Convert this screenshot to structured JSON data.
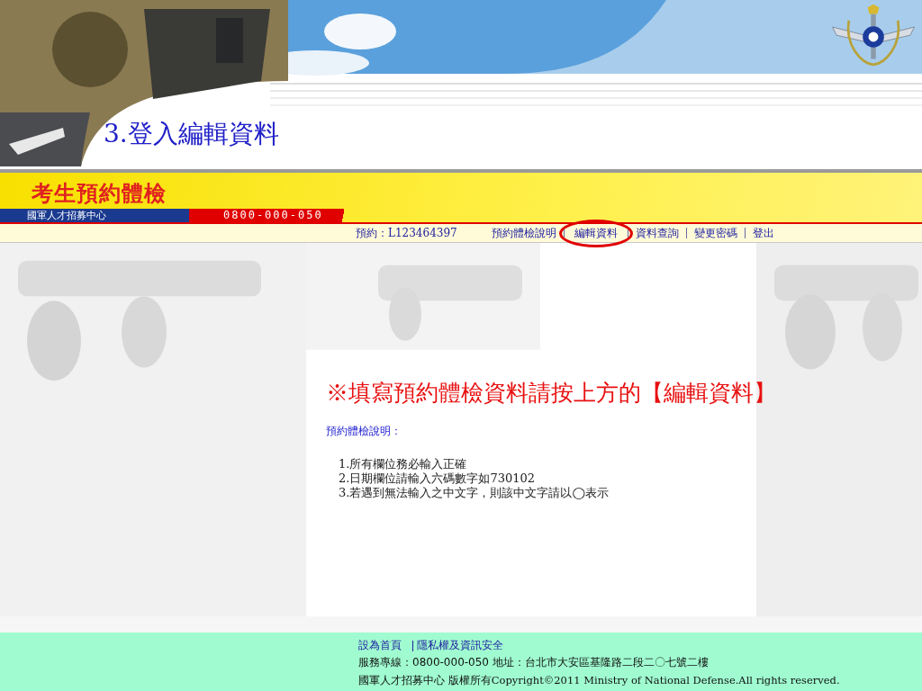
{
  "slide": {
    "title": "3.登入編輯資料"
  },
  "site": {
    "title": "考生預約體檢",
    "org": "國軍人才招募中心",
    "phone": "0800-000-050"
  },
  "nav": {
    "booking": "預約：L123464397",
    "links": [
      {
        "label": "預約體檢說明",
        "circled": false
      },
      {
        "label": "編輯資料",
        "circled": true
      },
      {
        "label": "資料查詢",
        "circled": false
      },
      {
        "label": "變更密碼",
        "circled": false
      },
      {
        "label": "登出",
        "circled": false
      }
    ]
  },
  "notice": "※填寫預約體檢資料請按上方的【編輯資料】",
  "instructions": {
    "heading": "預約體檢說明：",
    "items": [
      "1.所有欄位務必輸入正確",
      "2.日期欄位請輸入六碼數字如730102",
      "3.若遇到無法輸入之中文字，則該中文字請以◯表示"
    ]
  },
  "footer": {
    "links": [
      "設為首頁",
      "隱私權及資訊安全"
    ],
    "service": "服務專線：0800-000-050 地址：台北市大安區基隆路二段二〇七號二樓",
    "copyright": "國軍人才招募中心 版權所有Copyright©2011 Ministry of National Defense.All rights reserved."
  }
}
